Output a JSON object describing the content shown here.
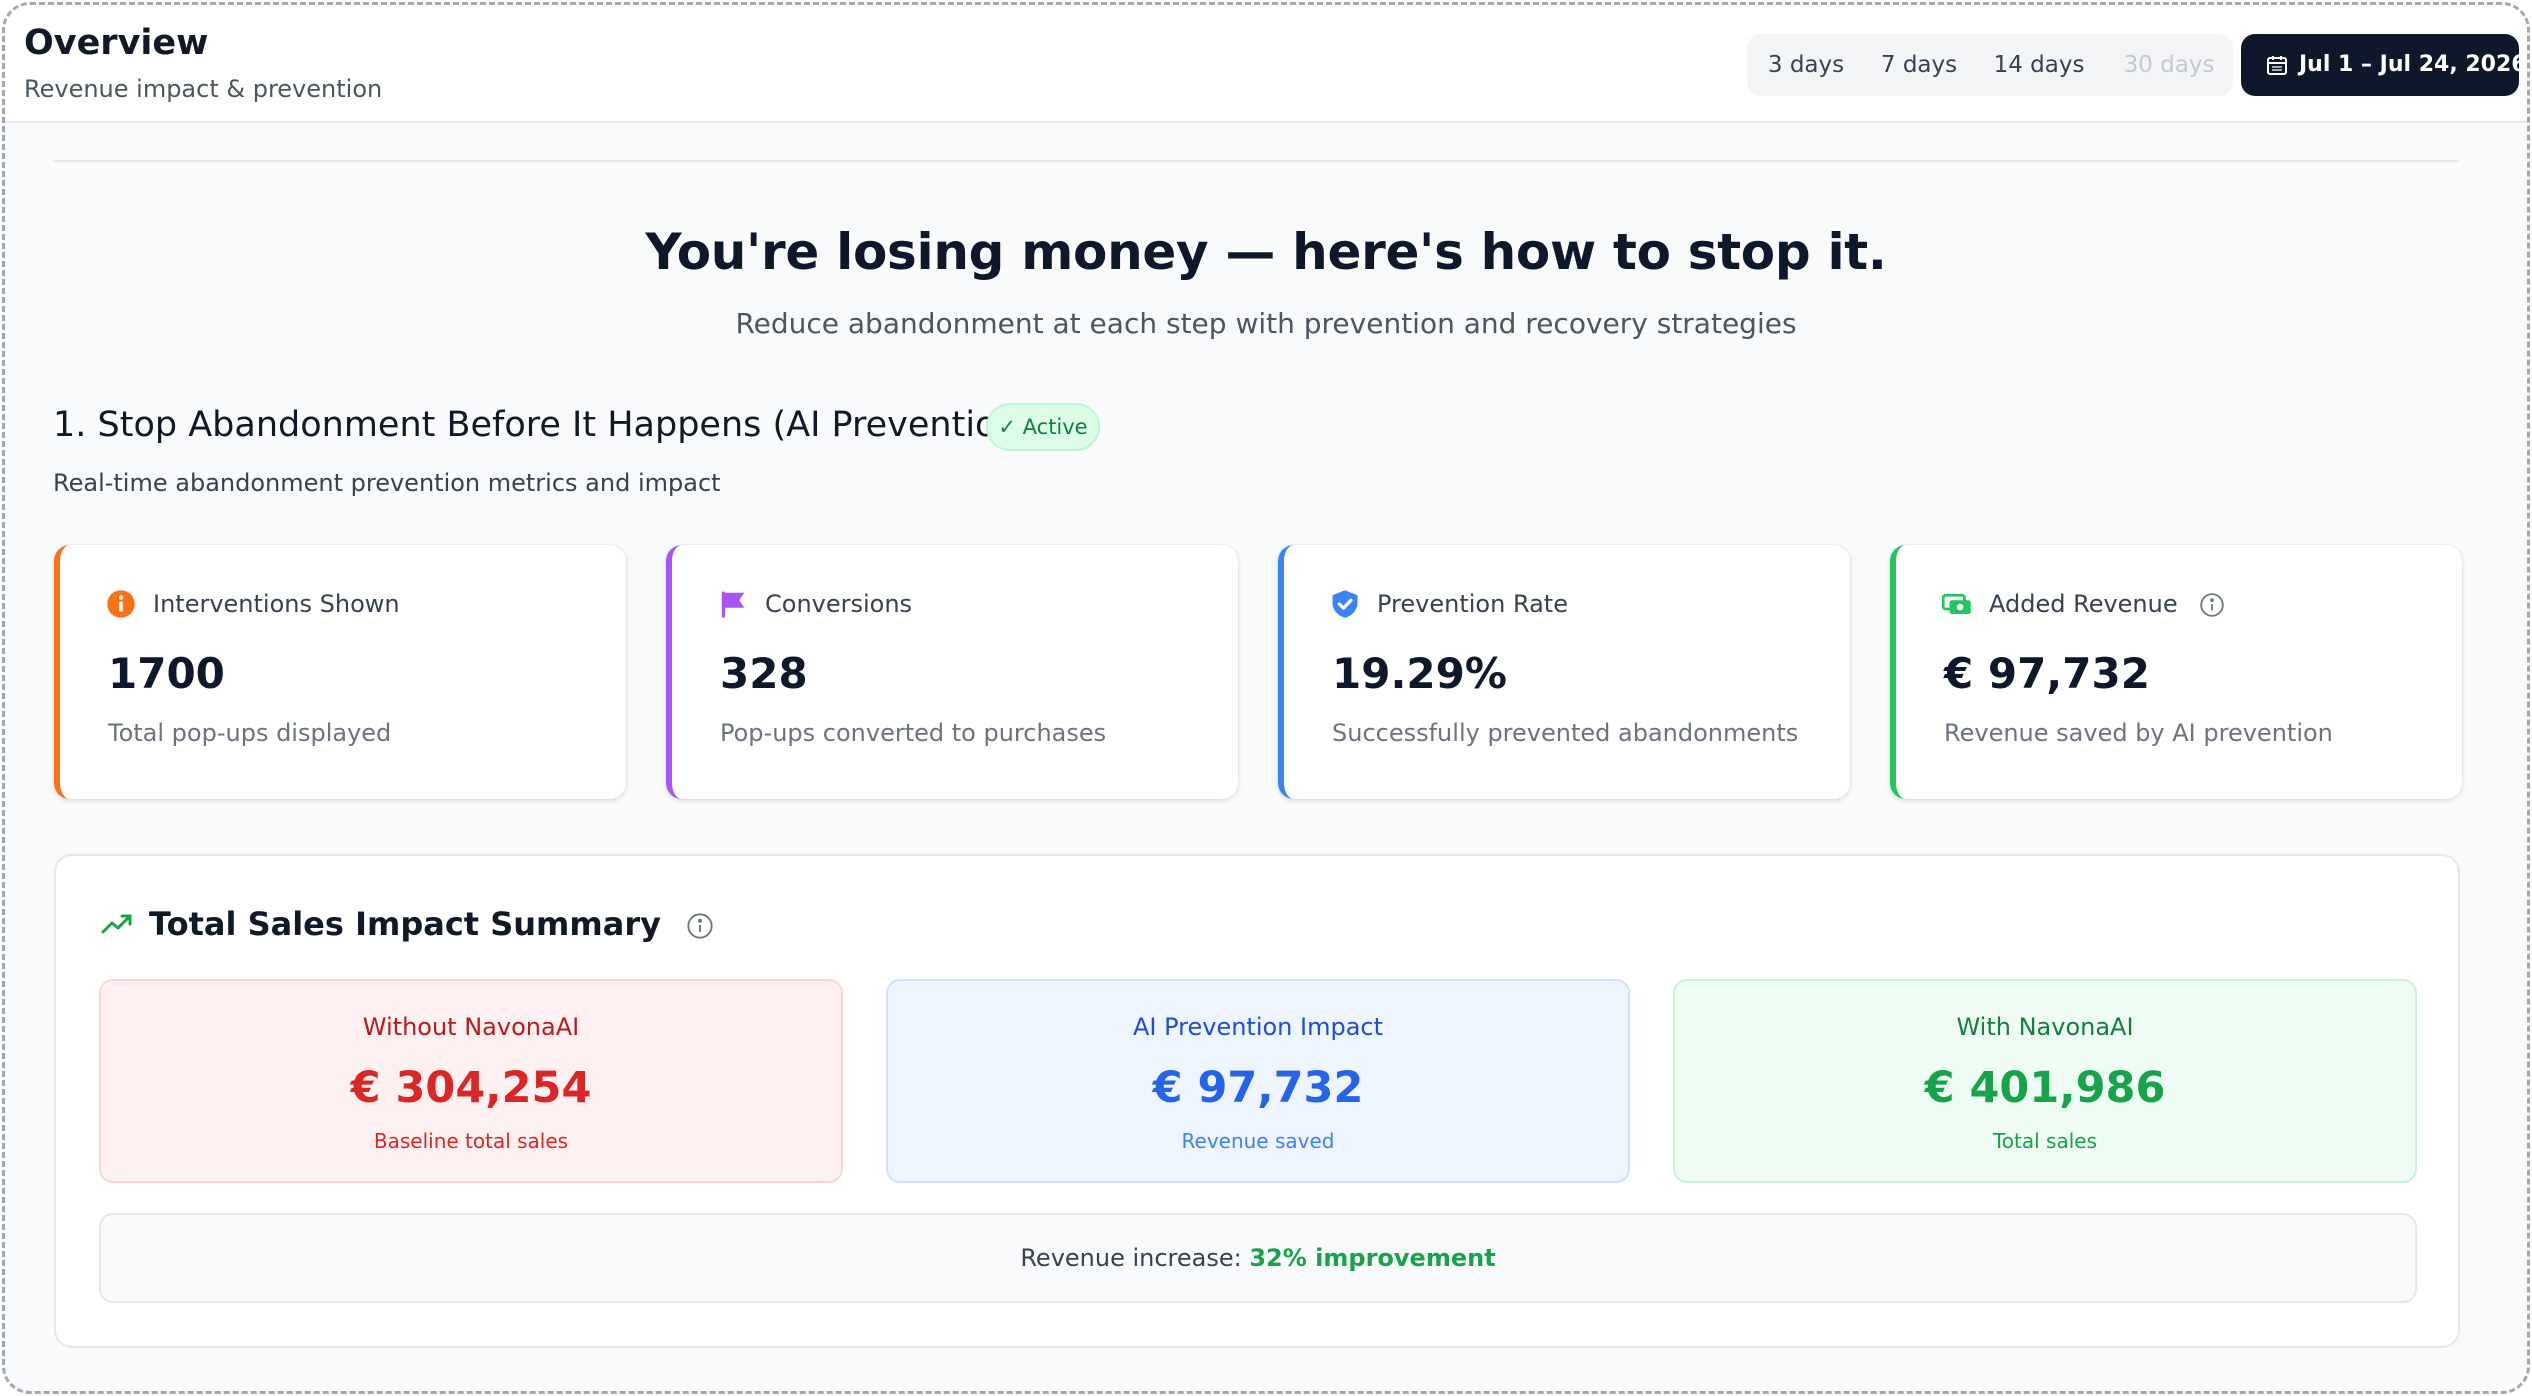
{
  "header": {
    "title": "Overview",
    "subtitle": "Revenue impact & prevention",
    "ranges": [
      {
        "label": "3 days",
        "disabled": false
      },
      {
        "label": "7 days",
        "disabled": false
      },
      {
        "label": "14 days",
        "disabled": false
      },
      {
        "label": "30 days",
        "disabled": true
      }
    ],
    "date_range": "Jul 1 – Jul 24, 2026"
  },
  "hero": {
    "title": "You're losing money — here's how to stop it.",
    "subtitle": "Reduce abandonment at each step with prevention and recovery strategies"
  },
  "section": {
    "title": "1. Stop Abandonment Before It Happens (AI Prevention)",
    "badge": "✓ Active",
    "description": "Real-time abandonment prevention metrics and impact"
  },
  "metrics": [
    {
      "label": "Interventions Shown",
      "value": "1700",
      "caption": "Total pop-ups displayed",
      "icon": "info-circle-icon",
      "color": "#f97316"
    },
    {
      "label": "Conversions",
      "value": "328",
      "caption": "Pop-ups converted to purchases",
      "icon": "flag-icon",
      "color": "#a855f7"
    },
    {
      "label": "Prevention Rate",
      "value": "19.29%",
      "caption": "Successfully prevented abandonments",
      "icon": "shield-check-icon",
      "color": "#3b82f6"
    },
    {
      "label": "Added Revenue",
      "value": "€ 97,732",
      "caption": "Revenue saved by AI prevention",
      "icon": "money-icon",
      "color": "#22c55e"
    }
  ],
  "summary": {
    "title": "Total Sales Impact Summary",
    "boxes": [
      {
        "title": "Without NavonaAI",
        "value": "€ 304,254",
        "caption": "Baseline total sales"
      },
      {
        "title": "AI Prevention Impact",
        "value": "€ 97,732",
        "caption": "Revenue saved"
      },
      {
        "title": "With NavonaAI",
        "value": "€ 401,986",
        "caption": "Total sales"
      }
    ],
    "increase_label": "Revenue increase:",
    "increase_value": "32% improvement"
  }
}
